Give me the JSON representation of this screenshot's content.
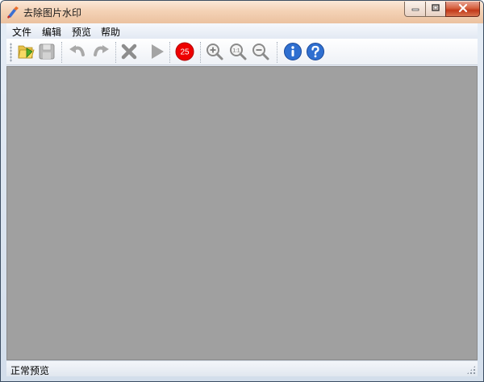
{
  "window": {
    "title": "去除图片水印",
    "app_icon": "brush-icon"
  },
  "window_controls": {
    "minimize_icon": "minimize-icon",
    "maximize_icon": "maximize-icon",
    "close_icon": "close-icon"
  },
  "menubar": {
    "items": [
      {
        "label": "文件"
      },
      {
        "label": "编辑"
      },
      {
        "label": "预览"
      },
      {
        "label": "帮助"
      }
    ]
  },
  "toolbar": {
    "buttons": [
      {
        "icon": "open-folder-icon"
      },
      {
        "icon": "save-icon",
        "enabled": false
      },
      {
        "icon": "undo-icon",
        "enabled": false
      },
      {
        "icon": "redo-icon",
        "enabled": false
      },
      {
        "icon": "delete-icon",
        "enabled": false
      },
      {
        "icon": "play-icon",
        "enabled": false
      },
      {
        "icon": "counter-badge-icon",
        "value": "25",
        "color": "#ee0000"
      },
      {
        "icon": "zoom-in-icon"
      },
      {
        "icon": "zoom-actual-size-icon",
        "text": "1:1"
      },
      {
        "icon": "zoom-out-icon"
      },
      {
        "icon": "info-icon"
      },
      {
        "icon": "help-icon"
      }
    ]
  },
  "canvas": {
    "background": "#a0a0a0"
  },
  "statusbar": {
    "text": "正常预览"
  }
}
